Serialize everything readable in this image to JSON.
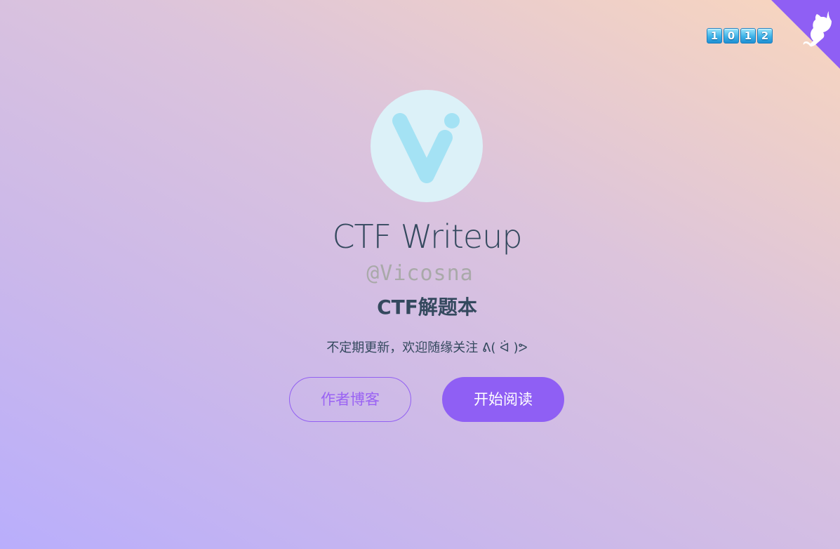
{
  "header": {
    "github_corner_icon": "github-octocat-icon",
    "corner_color": "#8f5ff4",
    "visit_counter": [
      "1",
      "0",
      "1",
      "2"
    ]
  },
  "cover": {
    "logo_icon": "vicosna-v-logo-icon",
    "title": "CTF Writeup",
    "author": "@Vicosna",
    "subtitle": "CTF解题本",
    "description": "不定期更新，欢迎随缘关注 ᕕ( ᐛ )ᕗ",
    "buttons": {
      "blog_label": "作者博客",
      "read_label": "开始阅读"
    }
  },
  "colors": {
    "accent": "#8f5ff4",
    "text_primary": "#34495e",
    "text_muted": "#a9a9a9",
    "logo_bg": "#dcf1f8",
    "logo_fg": "#a4e2f4"
  }
}
